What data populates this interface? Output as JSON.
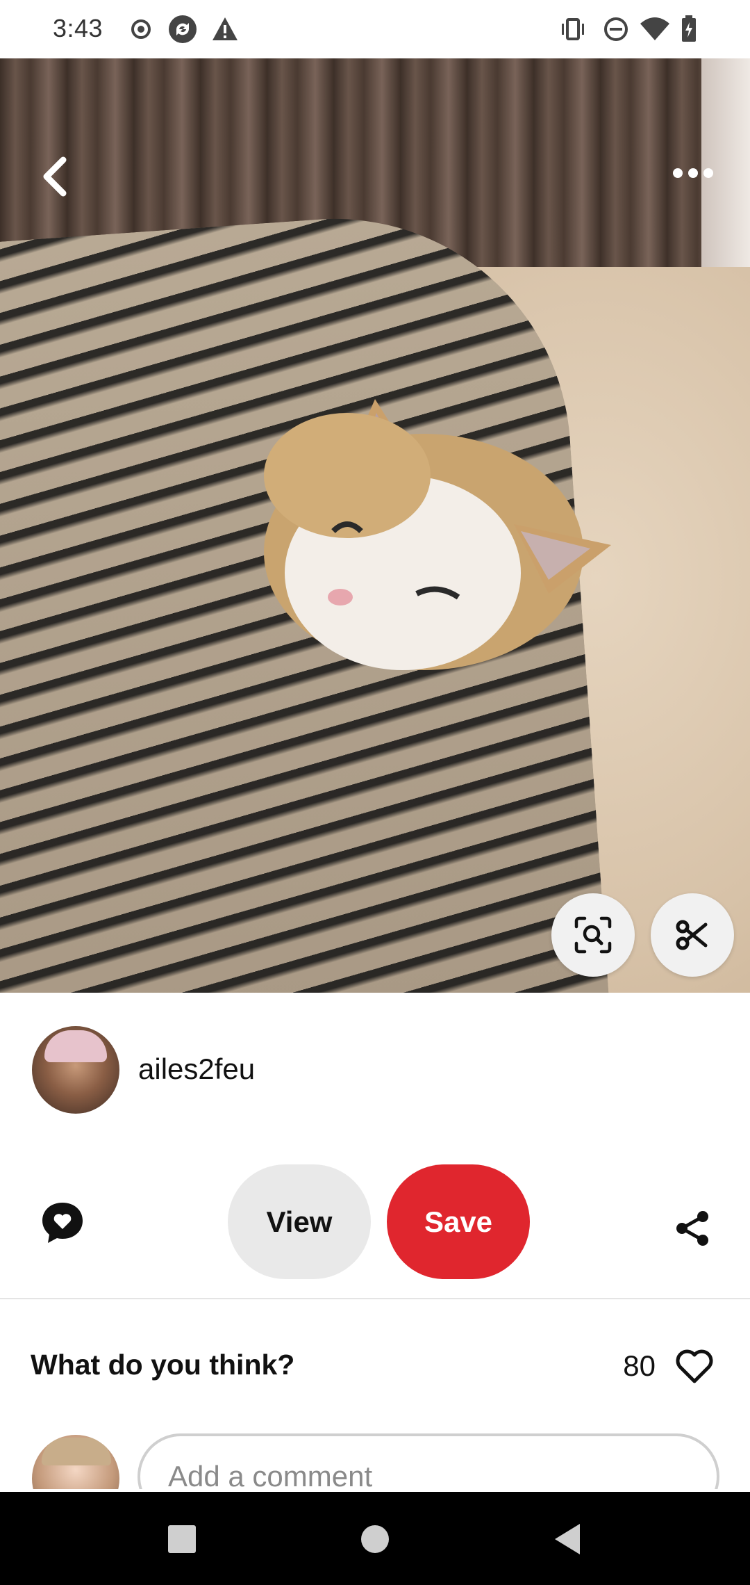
{
  "status_bar": {
    "time": "3:43",
    "left_icons": [
      "record-icon",
      "sync-icon",
      "alert-icon"
    ],
    "right_icons": [
      "vibrate-icon",
      "do-not-disturb-icon",
      "wifi-icon",
      "battery-charging-icon"
    ]
  },
  "pin": {
    "image_description_icon": "cat-photo",
    "back_icon": "chevron-left-icon",
    "more_icon": "more-horizontal-icon",
    "visual_search_icon": "lens-search-icon",
    "cutout_icon": "scissors-icon"
  },
  "author": {
    "name": "ailes2feu"
  },
  "actions": {
    "comment_icon": "chat-heart-icon",
    "view_label": "View",
    "save_label": "Save",
    "share_icon": "share-icon",
    "save_color": "#e0262e"
  },
  "comments": {
    "header": "What do you think?",
    "reaction_count": "80",
    "heart_icon": "heart-outline-icon",
    "input_placeholder": "Add a comment"
  },
  "nav_bar": {
    "items": [
      "recents-square-icon",
      "home-circle-icon",
      "back-triangle-icon"
    ]
  }
}
